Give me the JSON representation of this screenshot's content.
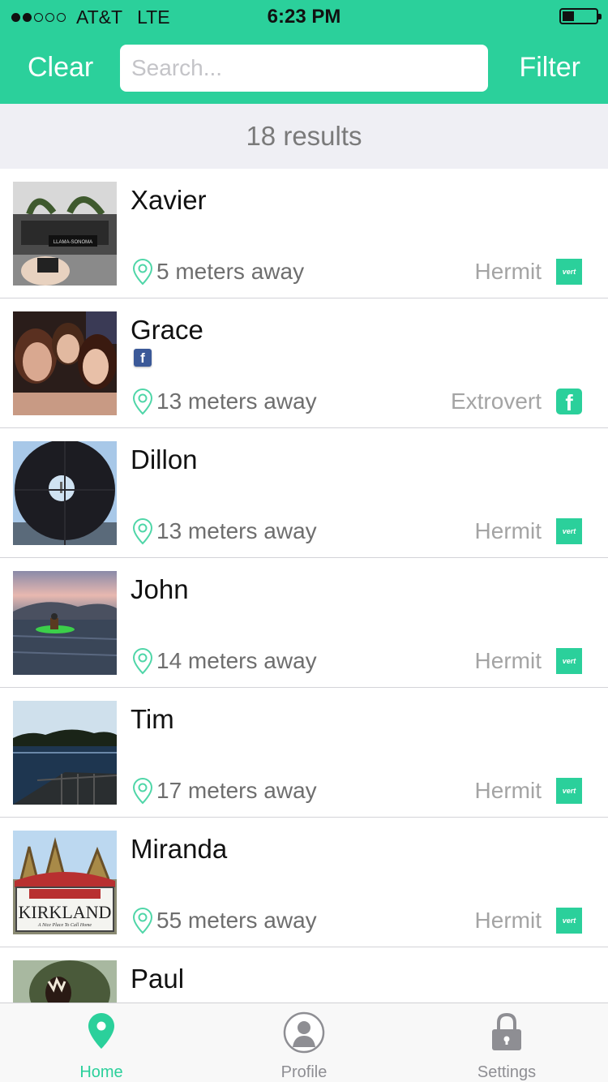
{
  "status_bar": {
    "carrier": "AT&T",
    "network": "LTE",
    "time": "6:23 PM"
  },
  "header": {
    "clear_label": "Clear",
    "search_placeholder": "Search...",
    "filter_label": "Filter"
  },
  "results_text": "18 results",
  "people": [
    {
      "name": "Xavier",
      "distance": "5 meters away",
      "type": "Hermit",
      "badge": "vert",
      "facebook": false
    },
    {
      "name": "Grace",
      "distance": "13 meters away",
      "type": "Extrovert",
      "badge": "f",
      "facebook": true
    },
    {
      "name": "Dillon",
      "distance": "13 meters away",
      "type": "Hermit",
      "badge": "vert",
      "facebook": false
    },
    {
      "name": "John",
      "distance": "14 meters away",
      "type": "Hermit",
      "badge": "vert",
      "facebook": false
    },
    {
      "name": "Tim",
      "distance": "17 meters away",
      "type": "Hermit",
      "badge": "vert",
      "facebook": false
    },
    {
      "name": "Miranda",
      "distance": "55 meters away",
      "type": "Hermit",
      "badge": "vert",
      "facebook": false
    },
    {
      "name": "Paul"
    }
  ],
  "photo_text": {
    "xavier_banner": "LLAMA-SONOMA",
    "kirkland_sign": "KIRKLAND",
    "kirkland_tagline": "A Nice Place To Call Home"
  },
  "facebook_mini": "f",
  "tabs": [
    {
      "label": "Home",
      "icon": "location-pin-icon",
      "active": true
    },
    {
      "label": "Profile",
      "icon": "person-icon",
      "active": false
    },
    {
      "label": "Settings",
      "icon": "lock-icon",
      "active": false
    }
  ],
  "colors": {
    "accent": "#2bd09b",
    "header_text": "#ffffff",
    "results_bar": "#efeff4"
  }
}
